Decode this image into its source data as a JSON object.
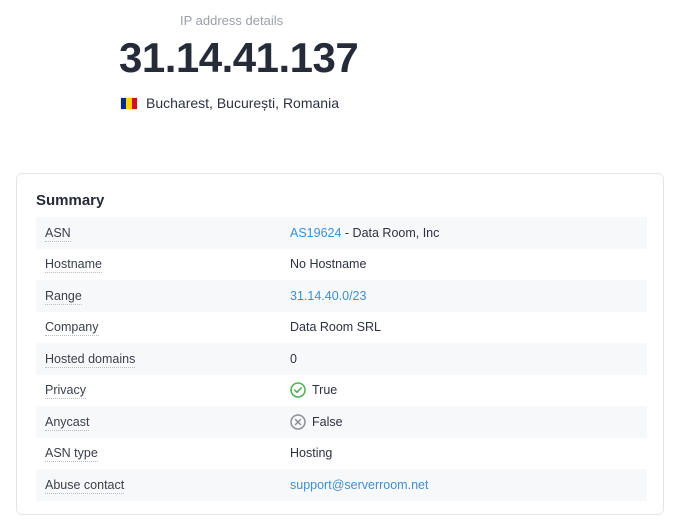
{
  "hero": {
    "subtitle": "IP address details",
    "ip": "31.14.41.137",
    "location": "Bucharest, București, Romania",
    "flag_colors": [
      "#002B7F",
      "#FCD116",
      "#CE1126"
    ]
  },
  "summary": {
    "title": "Summary",
    "rows": [
      {
        "label": "ASN",
        "link": "AS19624",
        "suffix": " - Data Room, Inc"
      },
      {
        "label": "Hostname",
        "value": "No Hostname"
      },
      {
        "label": "Range",
        "link": "31.14.40.0/23"
      },
      {
        "label": "Company",
        "value": "Data Room SRL"
      },
      {
        "label": "Hosted domains",
        "value": "0"
      },
      {
        "label": "Privacy",
        "value": "True",
        "icon": "check-circle-icon"
      },
      {
        "label": "Anycast",
        "value": "False",
        "icon": "x-circle-icon"
      },
      {
        "label": "ASN type",
        "value": "Hosting"
      },
      {
        "label": "Abuse contact",
        "link": "support@serverroom.net"
      }
    ]
  },
  "colors": {
    "link": "#3d8fd1",
    "check_icon": "#4caf50",
    "x_icon": "#8a8f99",
    "row_shade": "#f7f8f9"
  }
}
